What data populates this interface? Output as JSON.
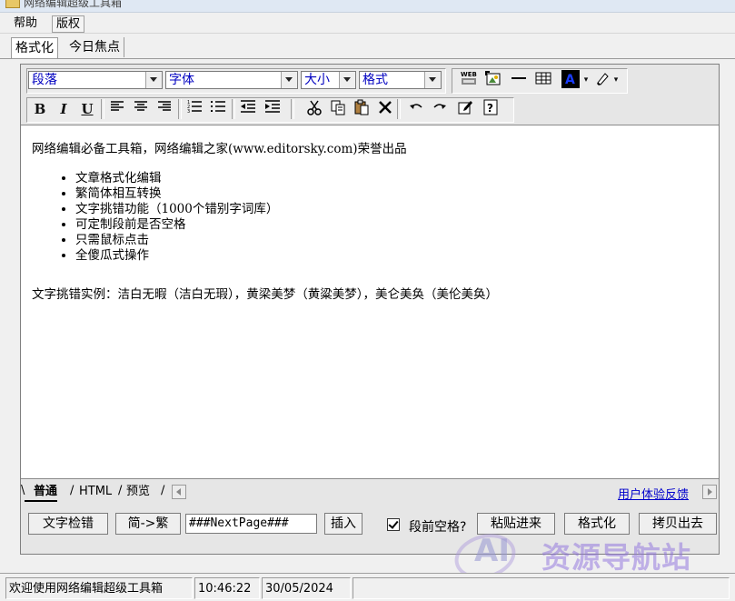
{
  "window": {
    "title": "网络编辑超级工具箱"
  },
  "menu": {
    "help": "帮助",
    "copyright": "版权"
  },
  "top_tabs": {
    "format": "格式化",
    "focus": "今日焦点"
  },
  "toolbar": {
    "paragraph": "段落",
    "font": "字体",
    "size": "大小",
    "style": "格式",
    "bold": "B",
    "italic": "I",
    "underline": "U",
    "text_color": "#000080"
  },
  "editor": {
    "intro": "网络编辑必备工具箱，网络编辑之家(www.editorsky.com)荣誉出品",
    "features": [
      "文章格式化编辑",
      "繁简体相互转换",
      "文字挑错功能（1000个错别字词库）",
      "可定制段前是否空格",
      "只需鼠标点击",
      "全傻瓜式操作"
    ],
    "example": "文字挑错实例：洁白无暇（洁白无瑕），黄梁美梦（黄粱美梦），美仑美奂（美伦美奂）"
  },
  "bottom_tabs": {
    "normal": "普通",
    "html": "HTML",
    "preview": "预览",
    "feedback": "用户体验反馈"
  },
  "actions": {
    "check": "文字检错",
    "convert": "简->繁",
    "pagebreak": "###NextPage###",
    "insert": "插入",
    "indent_label": "段前空格?",
    "indent_checked": true,
    "paste": "粘贴进来",
    "format": "格式化",
    "copy": "拷贝出去"
  },
  "watermark": {
    "ai": "AI",
    "text": "资源导航站"
  },
  "status": {
    "welcome": "欢迎使用网络编辑超级工具箱",
    "time": "10:46:22",
    "date": "30/05/2024"
  }
}
